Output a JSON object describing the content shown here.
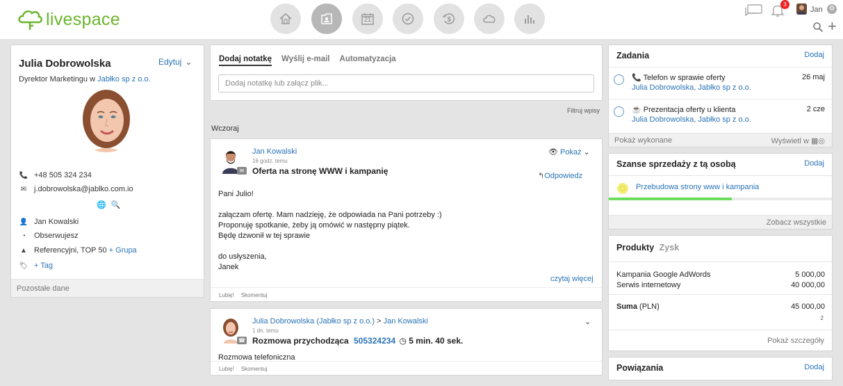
{
  "app": {
    "logo_text": "livespace"
  },
  "nav": [
    "home-icon",
    "contacts-icon",
    "calendar-icon",
    "tasks-icon",
    "deals-icon",
    "cloud-icon",
    "reports-icon"
  ],
  "nav_calendar_day": "21",
  "topright": {
    "notif_count": "3",
    "user": "Jan"
  },
  "contact": {
    "name": "Julia Dobrowolska",
    "edit_label": "Edytuj",
    "title_prefix": "Dyrektor Marketingu w",
    "company": "Jabłko sp z o.o.",
    "phone": "+48 505 324 234",
    "email": "j.dobrowolska@jablko.com.io",
    "owner": "Jan Kowalski",
    "watching": "Obserwujesz",
    "groups": "Referencyjni, TOP 50",
    "add_group": "+ Grupa",
    "add_tag": "+ Tag",
    "other_data": "Pozostałe dane"
  },
  "note": {
    "tabs": [
      "Dodaj notatkę",
      "Wyślij e-mail",
      "Automatyzacja"
    ],
    "placeholder": "Dodaj notatkę lub załącz plik...",
    "filter": "Filtruj wpisy",
    "day_label": "Wczoraj"
  },
  "post1": {
    "author": "Jan Kowalski",
    "time": "16 godz. temu",
    "subject": "Oferta na stronę WWW i kampanię",
    "show": "Pokaż",
    "reply": "Odpowiedz",
    "lines": [
      "Pani Julio!",
      "",
      "załączam ofertę. Mam nadzieję, że odpowiada na Pani potrzeby :)",
      "Proponuję spotkanie, żeby ją omówić w następny piątek.",
      "Będę dzwonił w tej sprawie",
      "",
      "do usłyszenia,",
      "Janek"
    ],
    "more": "czytaj więcej",
    "like": "Lubię!",
    "comment": "Skomentuj"
  },
  "post2": {
    "author": "Julia Dobrowolska (Jabłko sp z o.o.)",
    "arrow": ">",
    "to": "Jan Kowalski",
    "time": "1 dn. temu",
    "subject": "Rozmowa przychodząca",
    "phone": "505324234",
    "duration": "5 min. 40 sek.",
    "body": "Rozmowa telefoniczna",
    "like": "Lubię!",
    "comment": "Skomentuj"
  },
  "tasks": {
    "title": "Zadania",
    "add": "Dodaj",
    "items": [
      {
        "title": "Telefon w sprawie oferty",
        "person": "Julia Dobrowolska",
        "company": "Jabłko sp z o.o.",
        "date": "26 maj"
      },
      {
        "title": "Prezentacja oferty u klienta",
        "person": "Julia Dobrowolska",
        "company": "Jabłko sp z o.o.",
        "date": "2 cze"
      }
    ],
    "show_done": "Pokaż wykonane",
    "show_in": "Wyświetl w"
  },
  "deals": {
    "title": "Szanse sprzedaży z tą osobą",
    "add": "Dodaj",
    "item": "Przebudowa strony www i kampania",
    "progress": 0.55,
    "see_all": "Zobacz wszystkie"
  },
  "products": {
    "tabs": [
      "Produkty",
      "Zysk"
    ],
    "rows": [
      {
        "name": "Kampania Google AdWords",
        "value": "5 000,00"
      },
      {
        "name": "Serwis internetowy",
        "value": "40 000,00"
      }
    ],
    "sum_label": "Suma",
    "sum_unit": "(PLN)",
    "sum_value": "45 000,00",
    "count": "2",
    "details": "Pokaż szczegóły"
  },
  "relations": {
    "title": "Powiązania",
    "add": "Dodaj"
  },
  "colors": {
    "brand": "#6cb52d",
    "link": "#2a72b5",
    "progress": "#6bdc5b",
    "badge": "#e22222"
  }
}
